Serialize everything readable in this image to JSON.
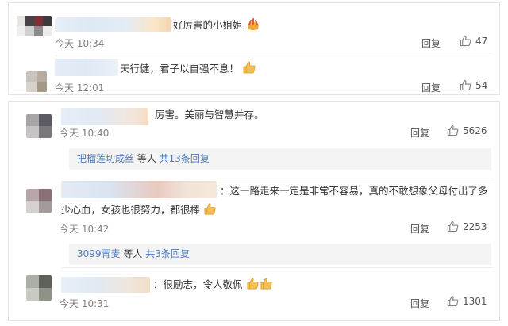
{
  "comments_top": [
    {
      "text": "好厉害的小姐姐",
      "time": "今天 10:34",
      "reply_label": "回复",
      "likes": "47"
    },
    {
      "text": "天行健，君子以自强不息！",
      "time": "今天 12:01",
      "reply_label": "回复",
      "likes": "54"
    }
  ],
  "comments_bottom": [
    {
      "text": "厉害。美丽与智慧并存。",
      "time": "今天 10:40",
      "reply_label": "回复",
      "likes": "5626",
      "sub": {
        "user": "把榴莲切成丝",
        "middle": " 等人 ",
        "count": "共13条回复"
      }
    },
    {
      "text_line1": "：这一路走来一定是非常不容易，真的不敢想象父母付出了多",
      "text_line2": "少心血，女孩也很努力，都很棒",
      "time": "今天 10:42",
      "reply_label": "回复",
      "likes": "2253",
      "sub": {
        "user": "3099青麦",
        "middle": " 等人 ",
        "count": "共3条回复"
      }
    },
    {
      "text": "：很励志，令人敬佩",
      "time": "今天 10:31",
      "reply_label": "回复",
      "likes": "1301"
    }
  ],
  "icons": {
    "like": "thumbs-up-icon",
    "emoji": "thumbs-up-emoji"
  },
  "colors": {
    "link": "#4a79b8",
    "subbox_bg": "#f4f4f4",
    "time": "#808080"
  }
}
